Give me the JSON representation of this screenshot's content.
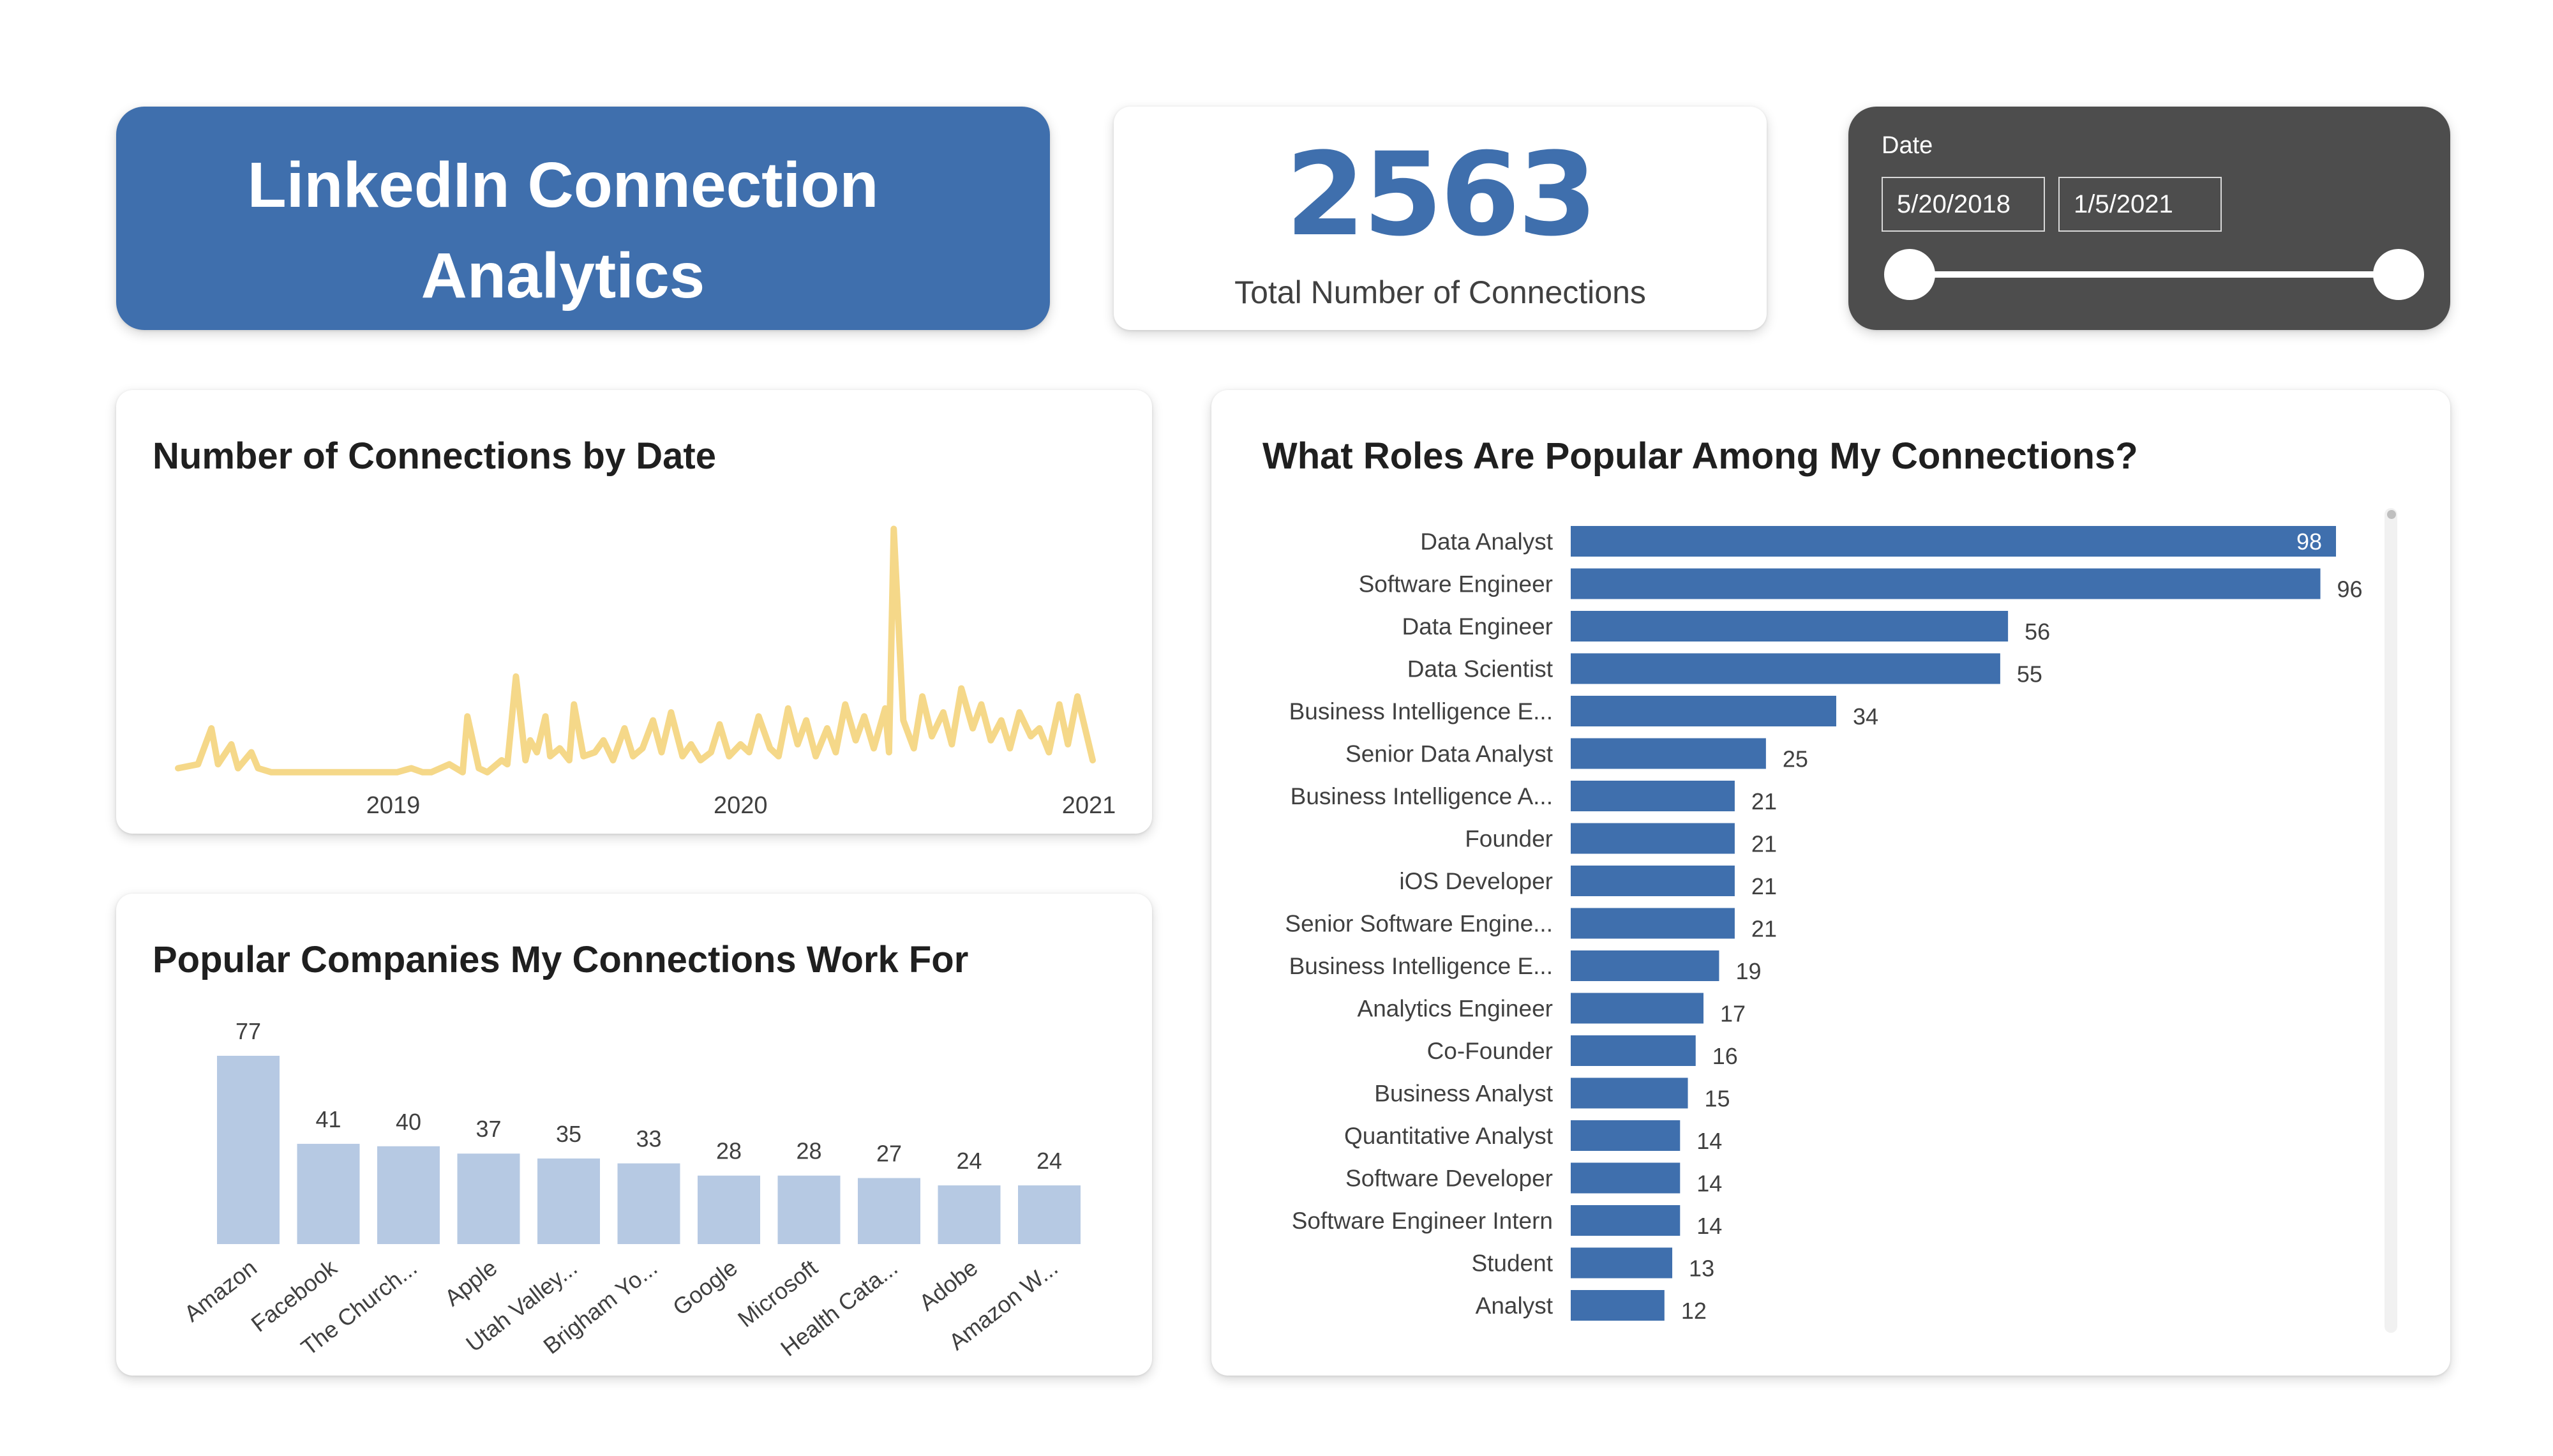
{
  "header": {
    "title_line1": "LinkedIn Connection",
    "title_line2": "Analytics",
    "title_color": "#3f6fad"
  },
  "kpi": {
    "value": "2563",
    "label": "Total Number of Connections"
  },
  "date_slicer": {
    "title": "Date",
    "start": "5/20/2018",
    "end": "1/5/2021",
    "background": "#4d4d4d"
  },
  "colors": {
    "bar_blue": "#3f6fad",
    "bar_light": "#b6c9e3",
    "line_yellow": "#f5d889"
  },
  "chart_data": [
    {
      "id": "line",
      "type": "line",
      "title": "Number of Connections by Date",
      "xlabel": "",
      "ylabel": "",
      "x_ticks": [
        "2019",
        "2020",
        "2021"
      ],
      "xlim": [
        "2018-05-20",
        "2021-01-05"
      ],
      "ylim": [
        0,
        60
      ],
      "color": "#f5d889",
      "x": [
        "2018-05-20",
        "2018-06-10",
        "2018-06-24",
        "2018-07-01",
        "2018-07-15",
        "2018-07-22",
        "2018-08-05",
        "2018-08-12",
        "2018-08-26",
        "2018-09-15",
        "2018-10-20",
        "2018-11-25",
        "2018-12-16",
        "2019-01-05",
        "2019-01-20",
        "2019-02-01",
        "2019-02-10",
        "2019-03-01",
        "2019-03-15",
        "2019-03-20",
        "2019-04-01",
        "2019-04-10",
        "2019-04-25",
        "2019-05-01",
        "2019-05-10",
        "2019-05-20",
        "2019-05-25",
        "2019-06-01",
        "2019-06-10",
        "2019-06-15",
        "2019-06-25",
        "2019-07-05",
        "2019-07-10",
        "2019-07-20",
        "2019-08-01",
        "2019-08-10",
        "2019-08-20",
        "2019-09-01",
        "2019-09-10",
        "2019-09-20",
        "2019-10-01",
        "2019-10-10",
        "2019-10-20",
        "2019-11-01",
        "2019-11-10",
        "2019-11-20",
        "2019-12-01",
        "2019-12-10",
        "2019-12-20",
        "2020-01-01",
        "2020-01-10",
        "2020-01-20",
        "2020-02-01",
        "2020-02-10",
        "2020-02-20",
        "2020-03-01",
        "2020-03-10",
        "2020-03-20",
        "2020-04-01",
        "2020-04-10",
        "2020-04-20",
        "2020-05-01",
        "2020-05-10",
        "2020-05-20",
        "2020-06-01",
        "2020-06-05",
        "2020-06-10",
        "2020-06-20",
        "2020-07-01",
        "2020-07-10",
        "2020-07-20",
        "2020-08-01",
        "2020-08-10",
        "2020-08-20",
        "2020-09-01",
        "2020-09-10",
        "2020-09-20",
        "2020-10-01",
        "2020-10-10",
        "2020-10-20",
        "2020-11-01",
        "2020-11-10",
        "2020-11-20",
        "2020-12-01",
        "2020-12-10",
        "2020-12-20",
        "2021-01-05"
      ],
      "y": [
        2,
        3,
        12,
        3,
        8,
        2,
        6,
        2,
        1,
        1,
        1,
        1,
        1,
        1,
        2,
        1,
        1,
        3,
        1,
        15,
        2,
        1,
        4,
        3,
        25,
        4,
        9,
        6,
        15,
        5,
        7,
        4,
        18,
        5,
        6,
        9,
        4,
        12,
        5,
        7,
        14,
        6,
        16,
        5,
        8,
        4,
        6,
        13,
        5,
        8,
        6,
        15,
        7,
        5,
        17,
        8,
        14,
        5,
        12,
        6,
        18,
        9,
        15,
        7,
        17,
        6,
        62,
        14,
        7,
        20,
        10,
        16,
        8,
        22,
        12,
        18,
        9,
        14,
        7,
        16,
        10,
        12,
        6,
        18,
        8,
        20,
        4
      ]
    },
    {
      "id": "companies",
      "type": "bar",
      "title": "Popular Companies My Connections Work For",
      "xlabel": "",
      "ylabel": "",
      "categories": [
        "Amazon",
        "Facebook",
        "The Church...",
        "Apple",
        "Utah Valley...",
        "Brigham Yo...",
        "Google",
        "Microsoft",
        "Health Cata...",
        "Adobe",
        "Amazon W..."
      ],
      "values": [
        77,
        41,
        40,
        37,
        35,
        33,
        28,
        28,
        27,
        24,
        24
      ],
      "ylim": [
        0,
        77
      ],
      "color": "#b6c9e3"
    },
    {
      "id": "roles",
      "type": "bar",
      "orientation": "horizontal",
      "title": "What Roles Are Popular Among My Connections?",
      "xlabel": "",
      "ylabel": "",
      "categories": [
        "Data Analyst",
        "Software Engineer",
        "Data Engineer",
        "Data Scientist",
        "Business Intelligence E...",
        "Senior Data Analyst",
        "Business Intelligence A...",
        "Founder",
        "iOS Developer",
        "Senior Software Engine...",
        "Business Intelligence E...",
        "Analytics Engineer",
        "Co-Founder",
        "Business Analyst",
        "Quantitative Analyst",
        "Software Developer",
        "Software Engineer Intern",
        "Student",
        "Analyst"
      ],
      "values": [
        98,
        96,
        56,
        55,
        34,
        25,
        21,
        21,
        21,
        21,
        19,
        17,
        16,
        15,
        14,
        14,
        14,
        13,
        12
      ],
      "xlim": [
        0,
        98
      ],
      "color": "#3f6fad"
    }
  ]
}
